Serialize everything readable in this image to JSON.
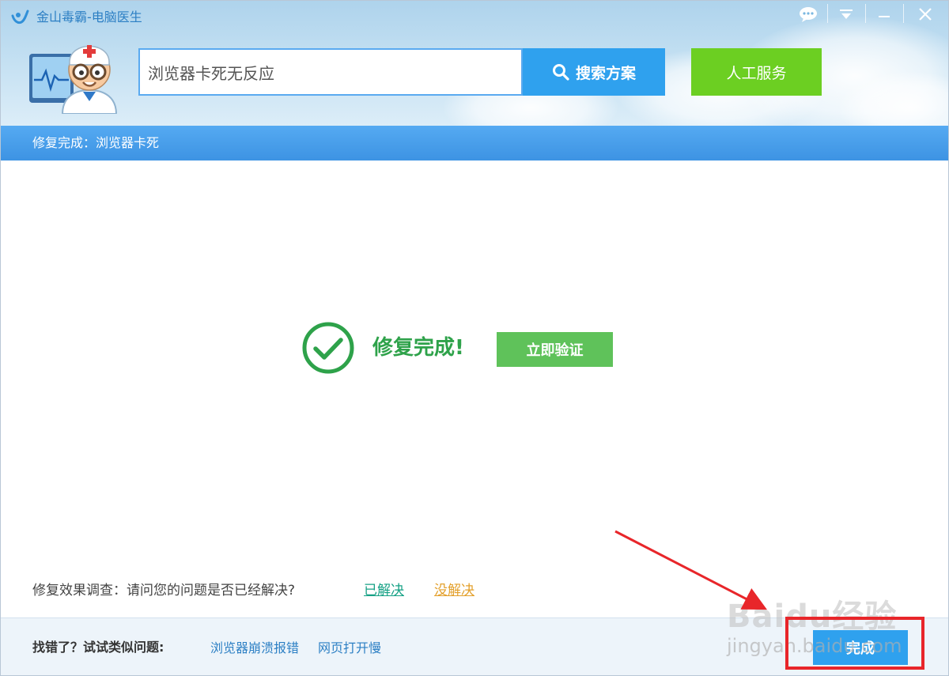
{
  "window": {
    "title": "金山毒霸-电脑医生",
    "controls": [
      "feedback",
      "menu",
      "minimize",
      "close"
    ]
  },
  "header": {
    "search_value": "浏览器卡死无反应",
    "search_button_label": "搜索方案",
    "human_service_label": "人工服务"
  },
  "status": {
    "text": "修复完成：浏览器卡死"
  },
  "result": {
    "title": "修复完成!",
    "verify_button_label": "立即验证"
  },
  "survey": {
    "question": "修复效果调查：请问您的问题是否已经解决?",
    "solved_label": "已解决",
    "unsolved_label": "没解决"
  },
  "footer": {
    "label": "找错了？试试类似问题:",
    "links": [
      "浏览器崩溃报错",
      "网页打开慢"
    ],
    "done_button_label": "完成"
  },
  "watermark": {
    "brand": "Baidu经验",
    "url": "jingyan.baidu.com"
  },
  "colors": {
    "primary_blue": "#2fa1ee",
    "status_bar_blue": "#3d93e3",
    "human_service_green": "#6ccf22",
    "success_green": "#2ea24a",
    "verify_green": "#5fc25a",
    "annotation_red": "#e8262a"
  }
}
